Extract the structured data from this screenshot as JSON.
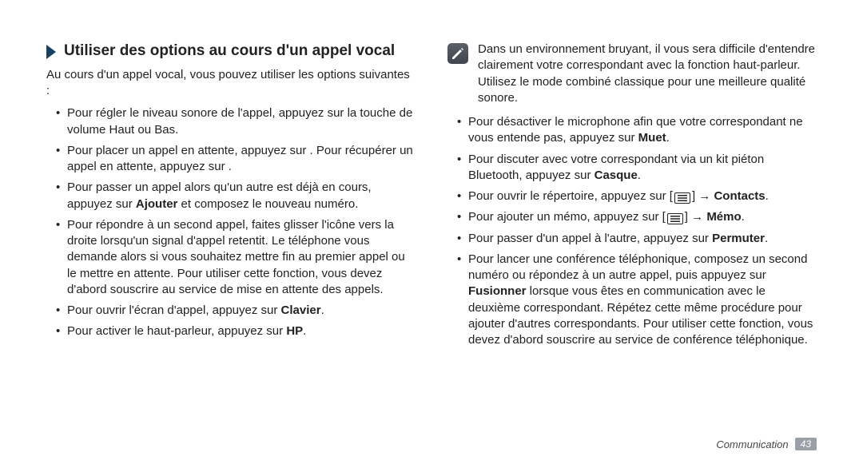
{
  "heading": "Utiliser des options au cours d'un appel vocal",
  "intro": "Au cours d'un appel vocal, vous pouvez utiliser les options suivantes :",
  "left_bullets": [
    {
      "pre": "Pour régler le niveau sonore de l'appel, appuyez sur la touche de volume Haut ou Bas."
    },
    {
      "pre": "Pour placer un appel en attente, appuyez sur      .\nPour récupérer un appel en attente, appuyez sur      ."
    },
    {
      "pre": "Pour passer un appel alors qu'un autre est déjà en cours, appuyez sur ",
      "bold1": "Ajouter",
      "post1": " et composez le nouveau numéro."
    },
    {
      "pre": "Pour répondre à un second appel, faites glisser l'icône     vers la droite lorsqu'un signal d'appel retentit. Le téléphone vous demande alors si vous souhaitez mettre fin au premier appel ou le mettre en attente. Pour utiliser cette fonction, vous devez d'abord souscrire au service de mise en attente des appels."
    },
    {
      "pre": "Pour ouvrir l'écran d'appel, appuyez sur ",
      "bold1": "Clavier",
      "post1": "."
    },
    {
      "pre": "Pour activer le haut-parleur, appuyez sur ",
      "bold1": "HP",
      "post1": "."
    }
  ],
  "note": "Dans un environnement bruyant, il vous sera difficile d'entendre clairement votre correspondant avec la fonction haut-parleur. Utilisez le mode combiné classique pour une meilleure qualité sonore.",
  "right_bullets": [
    {
      "pre": "Pour désactiver le microphone afin que votre correspondant ne vous entende pas, appuyez sur ",
      "bold1": "Muet",
      "post1": "."
    },
    {
      "pre": "Pour discuter avec votre correspondant via un kit piéton Bluetooth, appuyez sur ",
      "bold1": "Casque",
      "post1": "."
    },
    {
      "pre": "Pour ouvrir le répertoire, appuyez sur [",
      "menu": true,
      "mid": "] → ",
      "bold1": "Contacts",
      "post1": "."
    },
    {
      "pre": "Pour ajouter un mémo, appuyez sur [",
      "menu": true,
      "mid": "] → ",
      "bold1": "Mémo",
      "post1": "."
    },
    {
      "pre": "Pour passer d'un appel à l'autre, appuyez sur ",
      "bold1": "Permuter",
      "post1": "."
    },
    {
      "pre": "Pour lancer une conférence téléphonique, composez un second numéro ou répondez à un autre appel, puis appuyez sur ",
      "bold1": "Fusionner",
      "post1": " lorsque vous êtes en communication avec le deuxième correspondant. Répétez cette même procédure pour ajouter d'autres correspondants. Pour utiliser cette fonction, vous devez d'abord souscrire au service de conférence téléphonique."
    }
  ],
  "footer_section": "Communication",
  "footer_page": "43"
}
